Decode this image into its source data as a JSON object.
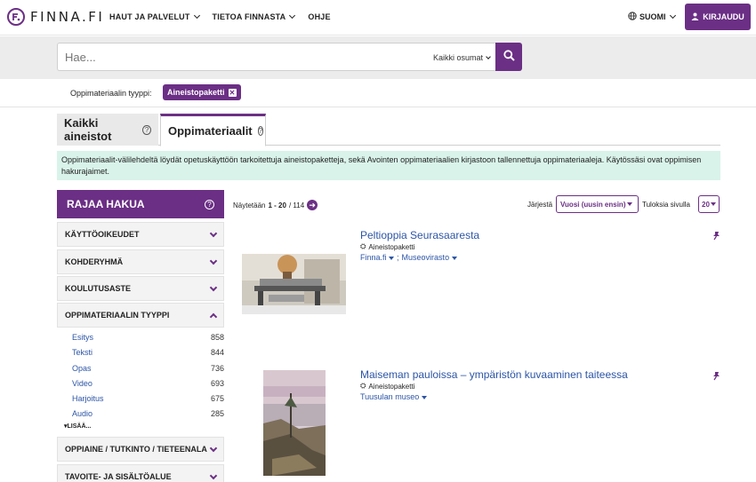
{
  "brand": {
    "name": "FINNA.FI"
  },
  "nav": {
    "items": [
      {
        "label": "HAUT JA PALVELUT"
      },
      {
        "label": "TIETOA FINNASTA"
      },
      {
        "label": "OHJE"
      }
    ],
    "language": "SUOMI",
    "login": "KIRJAUDU"
  },
  "search": {
    "placeholder": "Hae...",
    "scope": "Kaikki osumat"
  },
  "filter": {
    "label": "Oppimateriaalin tyyppi:",
    "chip": "Aineistopaketti",
    "chip_remove": "✕"
  },
  "tabs": [
    {
      "label": "Kaikki aineistot",
      "help": "?"
    },
    {
      "label": "Oppimateriaalit",
      "help": "?"
    }
  ],
  "info_text": "Oppimateriaalit-välilehdeltä löydät opetuskäyttöön tarkoitettuja aineistopaketteja, sekä Avointen oppimateriaalien kirjastoon tallennettuja oppimateriaaleja. Käytössäsi ovat oppimisen hakurajaimet.",
  "sidebar": {
    "title": "RAJAA HAKUA",
    "help": "?",
    "facets": [
      {
        "label": "KÄYTTÖOIKEUDET"
      },
      {
        "label": "KOHDERYHMÄ"
      },
      {
        "label": "KOULUTUSASTE"
      },
      {
        "label": "OPPIMATERIAALIN TYYPPI"
      },
      {
        "label": "OPPIAINE / TUTKINTO / TIETEENALA"
      },
      {
        "label": "TAVOITE- JA SISÄLTÖALUE"
      }
    ],
    "type_items": [
      {
        "label": "Esitys",
        "count": "858"
      },
      {
        "label": "Teksti",
        "count": "844"
      },
      {
        "label": "Opas",
        "count": "736"
      },
      {
        "label": "Video",
        "count": "693"
      },
      {
        "label": "Harjoitus",
        "count": "675"
      },
      {
        "label": "Audio",
        "count": "285"
      }
    ],
    "more": "▾LISÄÄ..."
  },
  "results_bar": {
    "showing_prefix": "Näytetään",
    "range": "1 - 20",
    "total": "/ 114",
    "sort_label": "Järjestä",
    "sort_value": "Vuosi (uusin ensin)",
    "per_page_label": "Tuloksia sivulla",
    "per_page_value": "20"
  },
  "results": [
    {
      "title": "Peltioppia Seurasaaresta",
      "type": "Aineistopaketti",
      "sources": [
        "Finna.fi",
        "Museovirasto"
      ],
      "separator": ";"
    },
    {
      "title": "Maiseman pauloissa – ympäristön kuvaaminen taiteessa",
      "type": "Aineistopaketti",
      "sources": [
        "Tuusulan museo"
      ]
    }
  ],
  "colors": {
    "brand": "#6b2f85",
    "link": "#2c55a6",
    "info_bg": "#d9f3ea"
  }
}
